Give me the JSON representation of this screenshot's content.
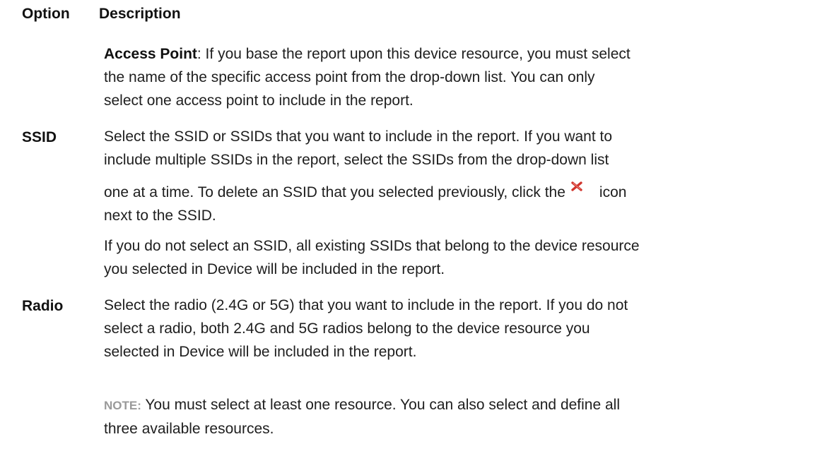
{
  "table": {
    "headers": {
      "option": "Option",
      "description": "Description"
    },
    "access_point": {
      "term": "Access Point",
      "lines": [
        ": If you base the report upon this device resource, you must select",
        "the name of the specific access point from the drop-down list. You can only",
        "select one access point to include in the report."
      ]
    },
    "ssid": {
      "option": "SSID",
      "lines": [
        "Select the SSID or SSIDs that you want to include in the report. If you want to",
        "include multiple SSIDs in the report, select the SSIDs from the drop-down list"
      ],
      "line3_before_icon": "one at a time. To delete an SSID that you selected previously, click the",
      "line3_after_icon": "icon",
      "line4": "next to the SSID.",
      "icon": "delete-x-icon",
      "icon_color": "#d0342c",
      "para2_lines": [
        "If you do not select an SSID, all existing SSIDs that belong to the device resource",
        "you selected in Device will be included in the report."
      ]
    },
    "radio": {
      "option": "Radio",
      "lines": [
        "Select the radio (2.4G or 5G) that you want to include in the report. If you do not",
        "select a radio, both 2.4G and 5G radios belong to the device resource you",
        "selected in Device will be included in the report."
      ]
    },
    "note": {
      "label": "NOTE:",
      "line1": " You must select at least one resource. You can also select and define all",
      "line2": "three available resources."
    }
  }
}
